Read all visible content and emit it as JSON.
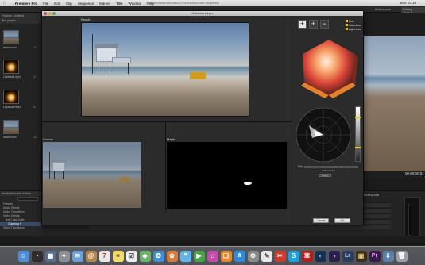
{
  "menubar": {
    "apple": "",
    "app": "Premiere Pro",
    "items": [
      "File",
      "Edit",
      "Clip",
      "Sequence",
      "Marker",
      "Title",
      "Window",
      "Help"
    ],
    "window_title": "/Users/Shared/Sandbox/Test/Nodes/Test Sequence",
    "clock": "Sun 23:18"
  },
  "workspace": {
    "name": "Workspace",
    "editing": "Editing (CS5.5)"
  },
  "project": {
    "header": "Project: Untitled",
    "bin": "Bin: project",
    "thumbs": [
      {
        "label": "beach.mov",
        "duration": "12:"
      },
      {
        "label": "Lightbulb.mp4",
        "duration": "4:"
      },
      {
        "label": "Lightbulb.mp4",
        "duration": "4:"
      },
      {
        "label": "beach.mov",
        "duration": "12:"
      }
    ]
  },
  "effects": {
    "tabs": [
      "Media Brow",
      "Info",
      "Effects"
    ],
    "items": [
      "Presets",
      "Audio Effects",
      "Audio Transitions",
      "Video Effects",
      "Bot Color Suite",
      "Colorista II",
      "Video Transitions"
    ]
  },
  "program": {
    "timecode": "00:00:00:01",
    "timeline_tc": "00:00:00:00"
  },
  "dialog": {
    "title": "Colorista Keyer",
    "result_label": "Result",
    "source_label": "Source",
    "matte_label": "Matte",
    "tools": [
      "+",
      "+",
      "−"
    ],
    "legend": [
      "Hue",
      "Saturation",
      "Lightness"
    ],
    "clip_label": "Clip",
    "softness_label": "Softness",
    "softness_value": "0.0",
    "reset_label": "Reset",
    "cancel_label": "Cancel",
    "ok_label": "OK"
  },
  "dock": {
    "icons": [
      "finder-icon",
      "dashboard-icon",
      "mission-control-icon",
      "launchpad-icon",
      "mail-icon",
      "contacts-icon",
      "calendar-icon",
      "notes-icon",
      "reminders-icon",
      "maps-icon",
      "safari-icon",
      "photos-icon",
      "messages-icon",
      "facetime-icon",
      "itunes-icon",
      "ibooks-icon",
      "app-store-icon",
      "system-prefs-icon",
      "preview-icon",
      "pdf-icon",
      "skype-icon",
      "acrobat-icon",
      "photoshop-icon",
      "after-effects-icon",
      "lightroom-icon",
      "bridge-icon",
      "premiere-icon",
      "downloads-icon",
      "trash-icon"
    ]
  }
}
